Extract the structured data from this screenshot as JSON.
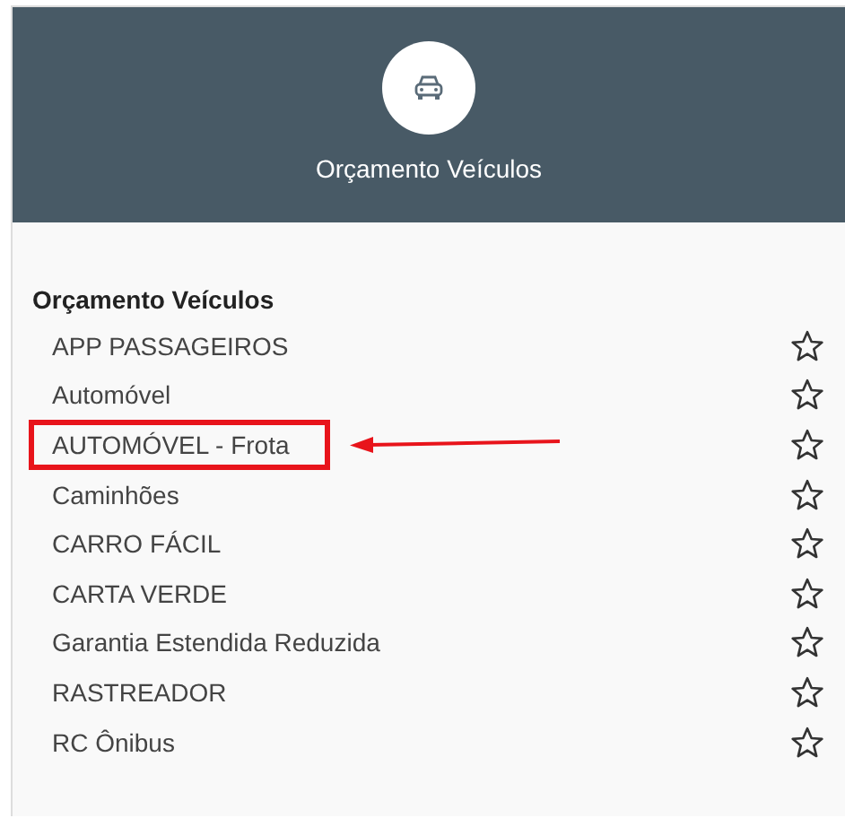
{
  "header": {
    "title": "Orçamento Veículos"
  },
  "group": {
    "heading": "Orçamento Veículos",
    "items": [
      {
        "label": "APP PASSAGEIROS",
        "favorite": false,
        "highlighted": false
      },
      {
        "label": "Automóvel",
        "favorite": false,
        "highlighted": false
      },
      {
        "label": "AUTOMÓVEL - Frota",
        "favorite": false,
        "highlighted": true
      },
      {
        "label": "Caminhões",
        "favorite": false,
        "highlighted": false
      },
      {
        "label": "CARRO FÁCIL",
        "favorite": false,
        "highlighted": false
      },
      {
        "label": "CARTA VERDE",
        "favorite": false,
        "highlighted": false
      },
      {
        "label": "Garantia Estendida Reduzida",
        "favorite": false,
        "highlighted": false
      },
      {
        "label": "RASTREADOR",
        "favorite": false,
        "highlighted": false
      },
      {
        "label": "RC Ônibus",
        "favorite": false,
        "highlighted": false
      }
    ]
  }
}
